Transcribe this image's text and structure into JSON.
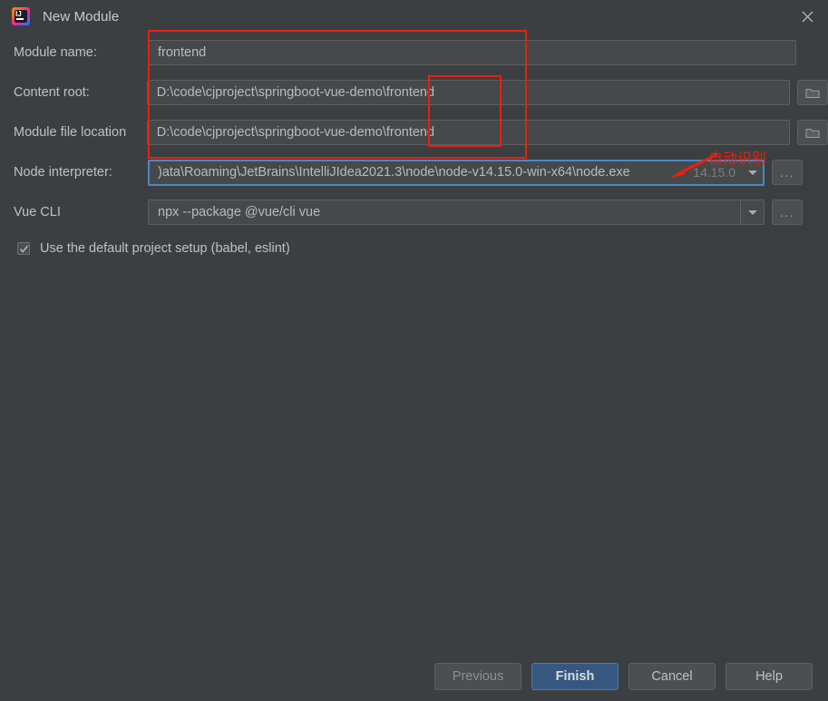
{
  "window": {
    "title": "New Module",
    "app_icon_label": "IJ",
    "close_icon": "close-icon"
  },
  "form": {
    "rows": [
      {
        "label": "Module name:",
        "value": "frontend",
        "type": "text"
      },
      {
        "label": "Content root:",
        "value": "D:\\code\\cjproject\\springboot-vue-demo\\frontend",
        "type": "path",
        "browse_icon": "folder-icon"
      },
      {
        "label": "Module file location",
        "value": "D:\\code\\cjproject\\springboot-vue-demo\\frontend",
        "type": "path",
        "browse_icon": "folder-icon"
      },
      {
        "label": "Node interpreter:",
        "value": ")ata\\Roaming\\JetBrains\\IntelliJIdea2021.3\\node\\node-v14.15.0-win-x64\\node.exe",
        "version": "14.15.0",
        "type": "combo-focused",
        "browse_label": "..."
      },
      {
        "label": "Vue CLI",
        "value": "npx --package @vue/cli vue",
        "type": "combo",
        "browse_label": "..."
      }
    ],
    "checkbox": {
      "label": "Use the default project setup (babel, eslint)",
      "checked": true,
      "check_glyph": "✓"
    }
  },
  "annotations": {
    "note_text": "自动识别",
    "color": "#e8200f"
  },
  "buttons": {
    "previous": "Previous",
    "finish": "Finish",
    "cancel": "Cancel",
    "help": "Help"
  },
  "colors": {
    "background": "#3c3f41",
    "field_bg": "#45494a",
    "focus_border": "#4a88c7",
    "primary_btn": "#365880",
    "annotation_red": "#e8200f",
    "text": "#bfc2c5"
  }
}
